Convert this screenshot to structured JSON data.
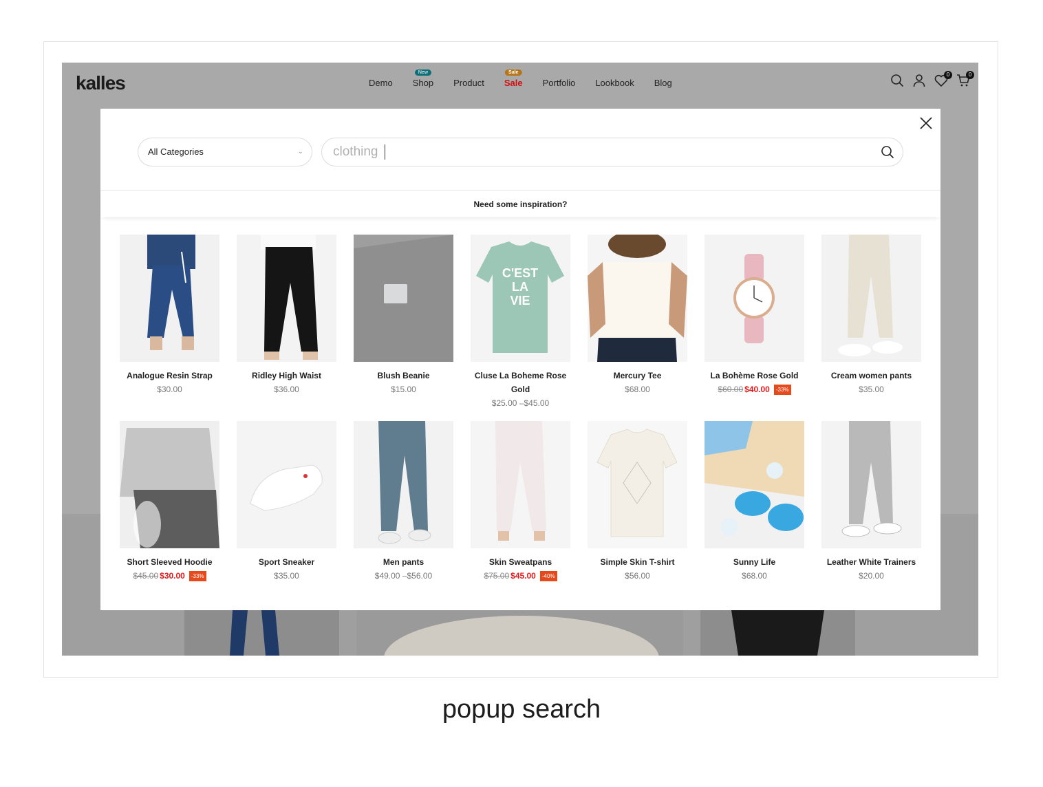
{
  "header": {
    "logo": "kalles",
    "nav": [
      {
        "label": "Demo",
        "badge": ""
      },
      {
        "label": "Shop",
        "badge": "New"
      },
      {
        "label": "Product",
        "badge": ""
      },
      {
        "label": "Sale",
        "badge": "Sale"
      },
      {
        "label": "Portfolio",
        "badge": ""
      },
      {
        "label": "Lookbook",
        "badge": ""
      },
      {
        "label": "Blog",
        "badge": ""
      }
    ],
    "wishlist_count": "0",
    "cart_count": "0"
  },
  "popup": {
    "category_select": "All Categories",
    "search_value": "clothing",
    "inspiration": "Need some inspiration?",
    "close_icon": "close-icon",
    "search_icon": "search-icon"
  },
  "products": [
    {
      "name": "Analogue Resin Strap",
      "price": "$30.00",
      "old": "",
      "new": "",
      "pct": ""
    },
    {
      "name": "Ridley High Waist",
      "price": "$36.00",
      "old": "",
      "new": "",
      "pct": ""
    },
    {
      "name": "Blush Beanie",
      "price": "$15.00",
      "old": "",
      "new": "",
      "pct": ""
    },
    {
      "name": "Cluse La Boheme Rose Gold",
      "price": "$25.00 –$45.00",
      "old": "",
      "new": "",
      "pct": ""
    },
    {
      "name": "Mercury Tee",
      "price": "$68.00",
      "old": "",
      "new": "",
      "pct": ""
    },
    {
      "name": "La Bohème Rose Gold",
      "price": "",
      "old": "$60.00",
      "new": "$40.00",
      "pct": "-33%"
    },
    {
      "name": "Cream women pants",
      "price": "$35.00",
      "old": "",
      "new": "",
      "pct": ""
    },
    {
      "name": "Short Sleeved Hoodie",
      "price": "",
      "old": "$45.00",
      "new": "$30.00",
      "pct": "-33%"
    },
    {
      "name": "Sport Sneaker",
      "price": "$35.00",
      "old": "",
      "new": "",
      "pct": ""
    },
    {
      "name": "Men pants",
      "price": "$49.00 –$56.00",
      "old": "",
      "new": "",
      "pct": ""
    },
    {
      "name": "Skin Sweatpans",
      "price": "",
      "old": "$75.00",
      "new": "$45.00",
      "pct": "-40%"
    },
    {
      "name": "Simple Skin T-shirt",
      "price": "$56.00",
      "old": "",
      "new": "",
      "pct": ""
    },
    {
      "name": "Sunny Life",
      "price": "$68.00",
      "old": "",
      "new": "",
      "pct": ""
    },
    {
      "name": "Leather White Trainers",
      "price": "$20.00",
      "old": "",
      "new": "",
      "pct": ""
    }
  ],
  "caption": "popup search",
  "colors": {
    "sale_red": "#e01b1b",
    "badge_new": "#0f6f78",
    "badge_sale": "#b8761b",
    "discount_bg": "#e44a1c"
  }
}
